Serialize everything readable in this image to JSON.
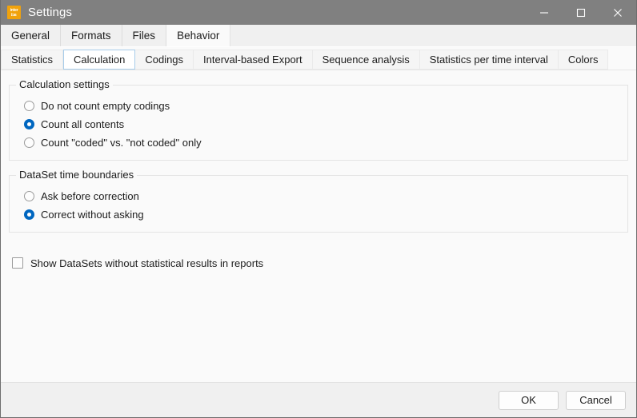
{
  "window": {
    "title": "Settings",
    "icon_name": "interact-app-icon",
    "icon_color": "#f0a20c",
    "icon_text_top": "inter",
    "icon_text_bottom": "act",
    "titlebar_color": "#808080",
    "controls": [
      {
        "name": "minimize-button",
        "glyph": "minimize"
      },
      {
        "name": "maximize-button",
        "glyph": "maximize"
      },
      {
        "name": "close-button",
        "glyph": "close"
      }
    ]
  },
  "outer_tabs": {
    "items": [
      {
        "label": "General",
        "active": false
      },
      {
        "label": "Formats",
        "active": false
      },
      {
        "label": "Files",
        "active": false
      },
      {
        "label": "Behavior",
        "active": true
      }
    ]
  },
  "inner_tabs": {
    "items": [
      {
        "label": "Statistics",
        "active": false
      },
      {
        "label": "Calculation",
        "active": true
      },
      {
        "label": "Codings",
        "active": false
      },
      {
        "label": "Interval-based Export",
        "active": false
      },
      {
        "label": "Sequence analysis",
        "active": false
      },
      {
        "label": "Statistics per time interval",
        "active": false
      },
      {
        "label": "Colors",
        "active": false
      }
    ],
    "accent_color": "#a8cdea"
  },
  "main": {
    "group_calculation": {
      "title": "Calculation settings",
      "options": [
        {
          "label": "Do not count empty codings",
          "selected": false
        },
        {
          "label": "Count all contents",
          "selected": true
        },
        {
          "label": "Count \"coded\" vs. \"not coded\" only",
          "selected": false
        }
      ]
    },
    "group_boundaries": {
      "title": "DataSet time boundaries",
      "options": [
        {
          "label": "Ask before correction",
          "selected": false
        },
        {
          "label": "Correct without asking",
          "selected": true
        }
      ]
    },
    "checkbox_reports": {
      "label": "Show DataSets without statistical results in reports",
      "checked": false
    },
    "selected_color": "#0067c0"
  },
  "footer": {
    "ok_label": "OK",
    "cancel_label": "Cancel"
  }
}
